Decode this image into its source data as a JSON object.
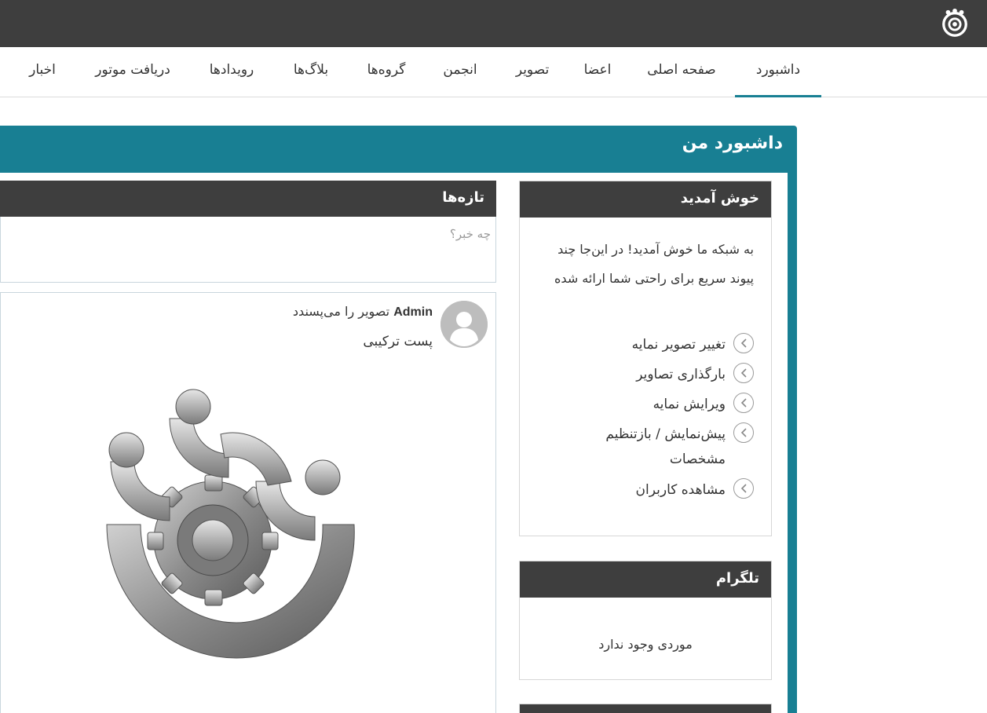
{
  "nav": {
    "items": [
      {
        "label": "داشبورد",
        "active": true
      },
      {
        "label": "صفحه اصلی"
      },
      {
        "label": "اعضا"
      },
      {
        "label": "تصویر"
      },
      {
        "label": "انجمن"
      },
      {
        "label": "گروه‌ها"
      },
      {
        "label": "بلاگ‌ها"
      },
      {
        "label": "رویدادها"
      },
      {
        "label": "دریافت موتور"
      },
      {
        "label": "اخبار"
      }
    ]
  },
  "dashboard": {
    "title": "داشبورد من"
  },
  "welcome": {
    "title": "خوش آمدید",
    "text": "به شبکه ما خوش آمدید! در این‌جا چند پیوند سریع برای راحتی شما ارائه شده",
    "links": [
      {
        "label": "تغییر تصویر نمایه"
      },
      {
        "label": "بارگذاری تصاویر"
      },
      {
        "label": "ویرایش نمایه"
      },
      {
        "label": "پیش‌نمایش / بازتنظیم مشخصات"
      },
      {
        "label": "مشاهده کاربران"
      }
    ]
  },
  "telegram": {
    "title": "تلگرام",
    "empty": "موردی وجود ندارد"
  },
  "feed": {
    "title": "تازه‌ها",
    "status_placeholder": "چه خبر؟",
    "post": {
      "author": "Admin",
      "action": " تصویر را می‌پسندد",
      "caption": "پست ترکیبی"
    }
  },
  "colors": {
    "accent": "#187f93",
    "topbar": "#3e3e3e",
    "panel_head": "#3e3e3e"
  }
}
